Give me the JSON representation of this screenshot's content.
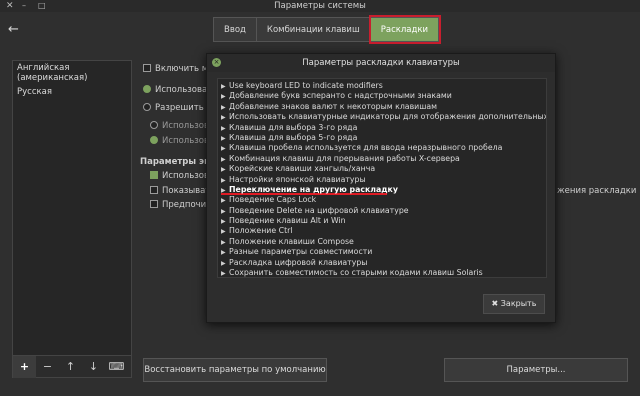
{
  "window": {
    "title": "Параметры системы",
    "close_glyph": "✕",
    "min_glyph": "–",
    "max_glyph": "□"
  },
  "nav": {
    "back_glyph": "←"
  },
  "tabs": [
    {
      "label": "Ввод"
    },
    {
      "label": "Комбинации клавиш"
    },
    {
      "label": "Раскладки"
    }
  ],
  "layouts": {
    "items": [
      "Английская (американская)",
      "Русская"
    ],
    "toolbar": [
      "+",
      "−",
      "↑",
      "↓",
      "⌨"
    ]
  },
  "options": {
    "enable_prefix": "Включить м",
    "use_prefix": "Использовать",
    "allow_prefix": "Разрешить о",
    "use_prefix2": "Использов",
    "use_prefix3": "Использов",
    "section_title": "Параметры экр",
    "use_prefix4": "Использов",
    "show_prefix": "Показыват",
    "prefer_prefix": "Предпочит",
    "right_fragment": "жения раскладки"
  },
  "bottom": {
    "restore_label": "Восстановить параметры по умолчанию",
    "params_label": "Параметры..."
  },
  "dialog": {
    "title": "Параметры раскладки клавиатуры",
    "close_glyph": "×",
    "items": [
      "Use keyboard LED to indicate modifiers",
      "Добавление букв эсперанто с надстрочными знаками",
      "Добавление знаков валют к некоторым клавишам",
      "Использовать клавиатурные индикаторы для отображения дополнительных ра",
      "Клавиша для выбора 3-го ряда",
      "Клавиша для выбора 5-го ряда",
      "Клавиша пробела используется для ввода неразрывного пробела",
      "Комбинация клавиш для прерывания работы X-сервера",
      "Корейские клавиши хангыль/ханча",
      "Настройки японской клавиатуры",
      "Переключение на другую раскладку",
      "Поведение Caps Lock",
      "Поведение Delete на цифровой клавиатуре",
      "Поведение клавиш Alt и Win",
      "Положение Ctrl",
      "Положение клавиши Compose",
      "Разные параметры совместимости",
      "Раскладка цифровой клавиатуры",
      "Сохранить совместимость со старыми кодами клавиш Solaris"
    ],
    "close_button_label": "✖ Закрыть"
  },
  "colors": {
    "accent": "#7da25e",
    "highlight": "#c81e2e",
    "underline": "#e01b24"
  }
}
